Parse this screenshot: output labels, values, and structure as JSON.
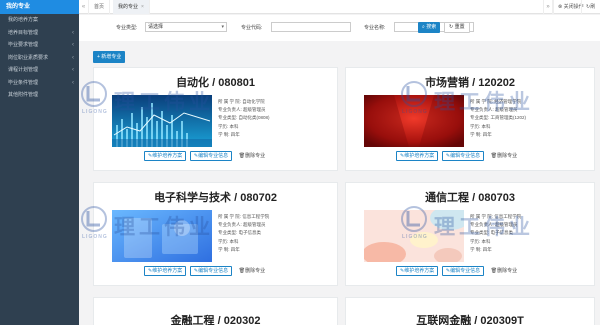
{
  "sidebar": {
    "title": "我的专业",
    "items": [
      {
        "label": "我的培养方案",
        "chevron": false
      },
      {
        "label": "培养目标管理",
        "chevron": true
      },
      {
        "label": "毕业要求管理",
        "chevron": true
      },
      {
        "label": "岗位职业素质要求",
        "chevron": true
      },
      {
        "label": "课程计划管理",
        "chevron": true
      },
      {
        "label": "毕业条件管理",
        "chevron": true
      },
      {
        "label": "其他附件管理",
        "chevron": false
      }
    ]
  },
  "topbar": {
    "back_arrow": "«",
    "home_tab": "首页",
    "active_tab": "我的专业",
    "close_glyph": "×",
    "forward_arrow": "»",
    "close_action": "关闭操作",
    "refresh": "刷新"
  },
  "filter": {
    "type_label": "专业类型:",
    "type_value": "请选择",
    "code_label": "专业代码:",
    "code_value": "",
    "name_label": "专业名称:",
    "name_value": "",
    "search_label": "搜索",
    "reset_label": "重置"
  },
  "add_button": "+ 新增专业",
  "card_buttons": {
    "maintain": "维护培养方案",
    "edit": "编辑专业信息",
    "delete": "删除专业"
  },
  "cards": [
    {
      "title": "自动化 / 080801",
      "image": "blue-data-chart",
      "info": [
        "所 属 学 院: 自动化学院",
        "专业负责人: 超级管理员",
        "专业类型: 自动化类(0808)",
        "学历: 本科",
        "学 制: 四年"
      ]
    },
    {
      "title": "市场营销 / 120202",
      "image": "red-stage",
      "info": [
        "所 属 学 院: 经济管理学院",
        "专业负责人: 超级管理员",
        "专业类型: 工商管理类(1202)",
        "学历: 本科",
        "学 制: 四年"
      ]
    },
    {
      "title": "电子科学与技术 / 080702",
      "image": "blue-gradient",
      "info": [
        "所 属 学 院: 信息工程学院",
        "专业负责人: 超级管理员",
        "专业类型: 电子信息类",
        "学历: 本科",
        "学 制: 四年"
      ]
    },
    {
      "title": "通信工程 / 080703",
      "image": "pastel-shapes",
      "info": [
        "所 属 学 院: 信息工程学院",
        "专业负责人: 超级管理员",
        "专业类型: 电子信息类",
        "学历: 本科",
        "学 制: 四年"
      ]
    },
    {
      "title": "金融工程 / 020302",
      "image": "",
      "info": []
    },
    {
      "title": "互联网金融 / 020309T",
      "image": "",
      "info": []
    }
  ],
  "watermark": {
    "text": "理工伟业",
    "sub": "LIGONG"
  },
  "colors": {
    "sidebar": "#2f4050",
    "accent": "#1c84c6",
    "sidebar_active": "#1f8ce2"
  }
}
